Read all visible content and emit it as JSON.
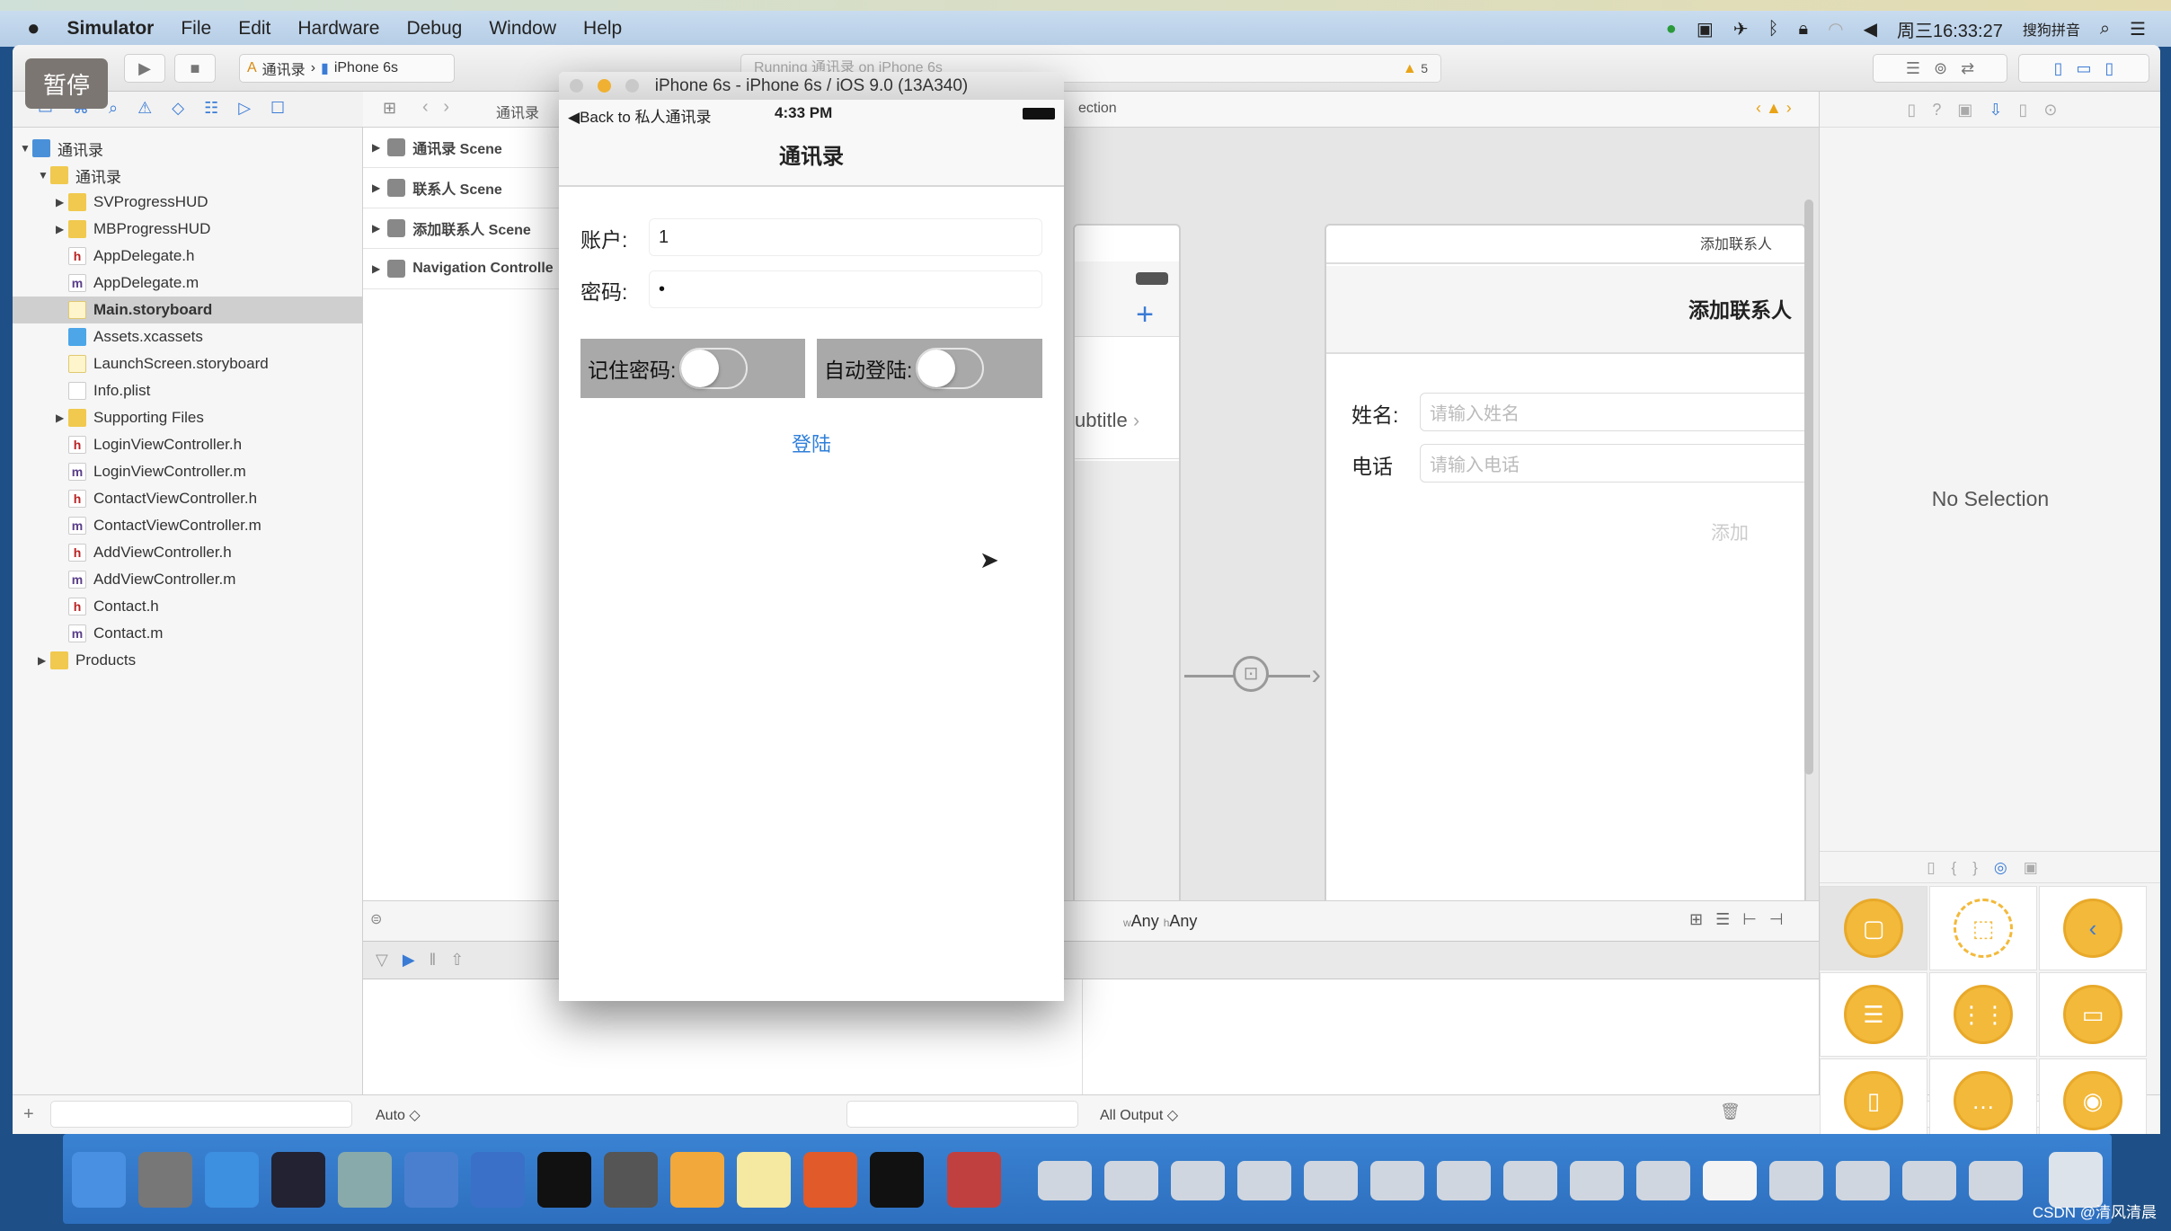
{
  "menubar": {
    "app": "Simulator",
    "items": [
      "File",
      "Edit",
      "Hardware",
      "Debug",
      "Window",
      "Help"
    ],
    "clock": "周三16:33:27",
    "ime": "搜狗拼音"
  },
  "toolbar": {
    "pause_overlay": "暂停",
    "scheme": "通讯录",
    "device": "iPhone 6s",
    "activity": "Running 通讯录 on iPhone 6s",
    "warnings": "5"
  },
  "navigator": {
    "items": [
      {
        "label": "通讯录",
        "type": "project",
        "depth": 0,
        "open": true
      },
      {
        "label": "通讯录",
        "type": "folder",
        "depth": 1,
        "open": true
      },
      {
        "label": "SVProgressHUD",
        "type": "folder",
        "depth": 2,
        "open": false
      },
      {
        "label": "MBProgressHUD",
        "type": "folder",
        "depth": 2,
        "open": false
      },
      {
        "label": "AppDelegate.h",
        "type": "h",
        "depth": 2
      },
      {
        "label": "AppDelegate.m",
        "type": "m",
        "depth": 2
      },
      {
        "label": "Main.storyboard",
        "type": "storyboard",
        "depth": 2,
        "selected": true
      },
      {
        "label": "Assets.xcassets",
        "type": "xcassets",
        "depth": 2
      },
      {
        "label": "LaunchScreen.storyboard",
        "type": "storyboard",
        "depth": 2
      },
      {
        "label": "Info.plist",
        "type": "plist",
        "depth": 2
      },
      {
        "label": "Supporting Files",
        "type": "folder",
        "depth": 2,
        "open": false
      },
      {
        "label": "LoginViewController.h",
        "type": "h",
        "depth": 2
      },
      {
        "label": "LoginViewController.m",
        "type": "m",
        "depth": 2
      },
      {
        "label": "ContactViewController.h",
        "type": "h",
        "depth": 2
      },
      {
        "label": "ContactViewController.m",
        "type": "m",
        "depth": 2
      },
      {
        "label": "AddViewController.h",
        "type": "h",
        "depth": 2
      },
      {
        "label": "AddViewController.m",
        "type": "m",
        "depth": 2
      },
      {
        "label": "Contact.h",
        "type": "h",
        "depth": 2
      },
      {
        "label": "Contact.m",
        "type": "m",
        "depth": 2
      },
      {
        "label": "Products",
        "type": "folder",
        "depth": 1,
        "open": false
      }
    ]
  },
  "jumpbar": {
    "crumb": "通讯录",
    "tail": "ection"
  },
  "outline": {
    "scenes": [
      "通讯录 Scene",
      "联系人 Scene",
      "添加联系人 Scene",
      "Navigation Controlle"
    ]
  },
  "simulator": {
    "title": "iPhone 6s - iPhone 6s / iOS 9.0 (13A340)",
    "back": "Back to 私人通讯录",
    "time": "4:33 PM",
    "nav_title": "通讯录",
    "account_label": "账户:",
    "account_value": "1",
    "password_label": "密码:",
    "password_value": "•",
    "remember_label": "记住密码:",
    "remember_on": false,
    "autologin_label": "自动登陆:",
    "autologin_on": false,
    "login_button": "登陆"
  },
  "canvas": {
    "contact_scene": {
      "subtitle": "ubtitle",
      "add_icon": "plus-icon"
    },
    "add_scene": {
      "header": "添加联系人",
      "title": "添加联系人",
      "name_label": "姓名:",
      "name_placeholder": "请输入姓名",
      "phone_label": "电话",
      "phone_placeholder": "请输入电话",
      "add_button": "添加"
    },
    "size_class": {
      "w": "Any",
      "h": "Any"
    }
  },
  "debug": {
    "auto": "Auto ◇",
    "output": "All Output ◇"
  },
  "inspector": {
    "empty": "No Selection"
  },
  "watermark": "CSDN @清风清晨",
  "colors": {
    "accent": "#2f7fd9",
    "library": "#f3b93a"
  }
}
